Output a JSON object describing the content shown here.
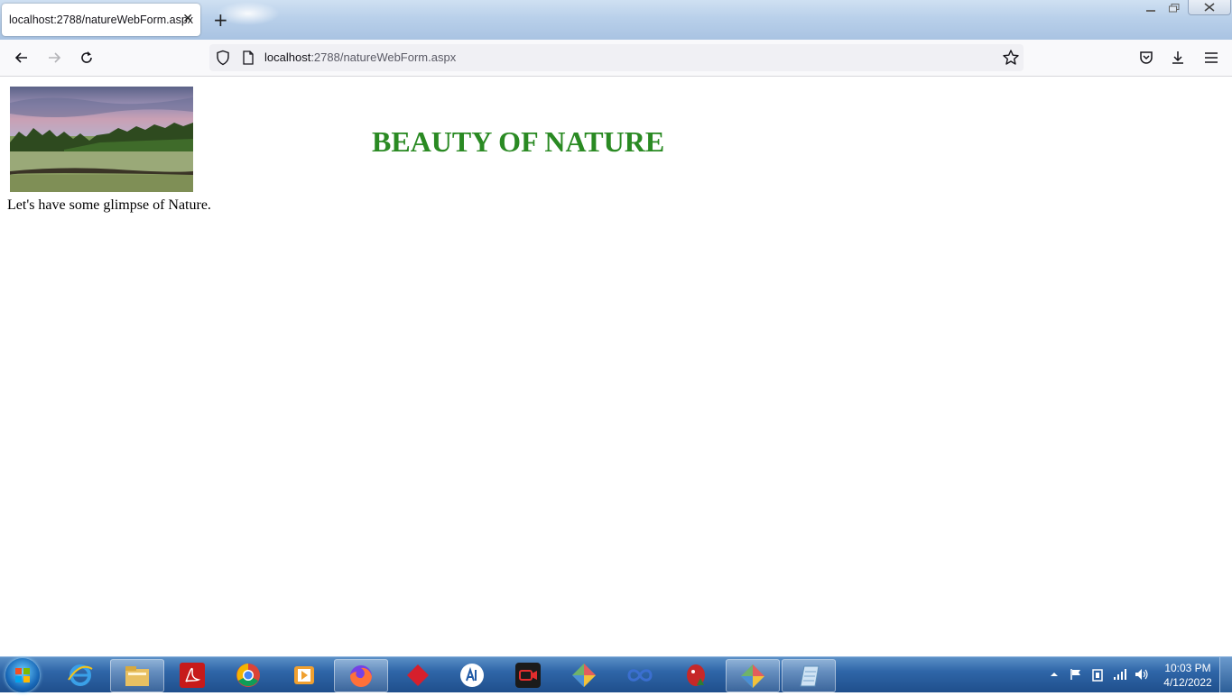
{
  "browser": {
    "tab_title": "localhost:2788/natureWebForm.aspx",
    "tab_close": "✕",
    "new_tab": "+",
    "url_host": "localhost",
    "url_rest": ":2788/natureWebForm.aspx"
  },
  "page": {
    "heading": "BEAUTY OF NATURE",
    "caption": "Let's have some glimpse of Nature.",
    "heading_color": "#2a8a23"
  },
  "taskbar": {
    "apps": [
      "internet-explorer-icon",
      "file-explorer-icon",
      "acrobat-icon",
      "chrome-icon",
      "media-player-icon",
      "firefox-icon",
      "red-diamond-app-icon",
      "word-app-icon",
      "screen-recorder-icon",
      "git-app-icon",
      "infinity-app-icon",
      "parrot-app-icon",
      "git-app-icon-2",
      "notepad-icon"
    ],
    "clock_time": "10:03 PM",
    "clock_date": "4/12/2022"
  }
}
